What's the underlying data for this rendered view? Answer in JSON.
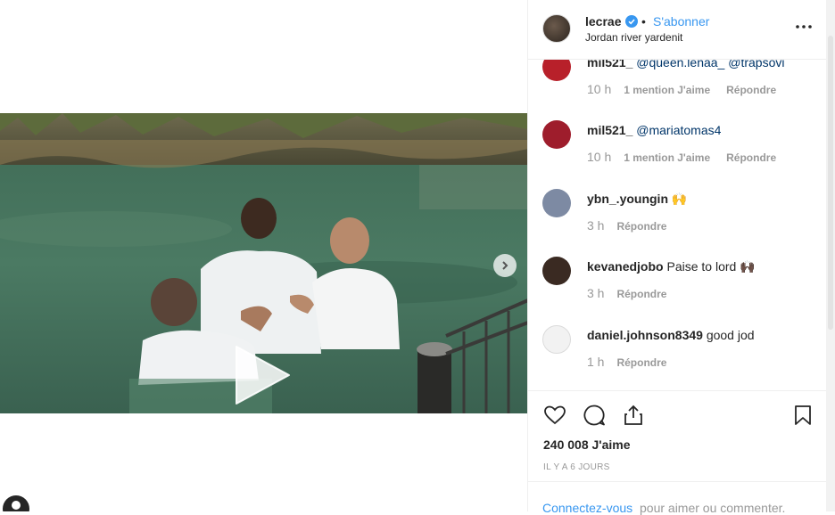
{
  "post": {
    "username": "lecrae",
    "dot": "•",
    "follow_label": "S'abonner",
    "location": "Jordan river yardenit",
    "likes": "240 008 J'aime",
    "timestamp": "IL Y A 6 JOURS"
  },
  "comments": [
    {
      "username": "mil521_",
      "text": "",
      "mentions": "@queen.lenaa_ @trapsovi",
      "time": "10 h",
      "likes": "1 mention J'aime",
      "reply": "Répondre",
      "avatar_color": "#b8202a"
    },
    {
      "username": "mil521_",
      "text": "",
      "mentions": "@mariatomas4",
      "time": "10 h",
      "likes": "1 mention J'aime",
      "reply": "Répondre",
      "avatar_color": "#9e1d2c"
    },
    {
      "username": "ybn_.youngin",
      "text": "🙌",
      "mentions": "",
      "time": "3 h",
      "likes": "",
      "reply": "Répondre",
      "avatar_color": "#7d8aa3"
    },
    {
      "username": "kevanedjobo",
      "text": "Paise to lord 🙌🏿",
      "mentions": "",
      "time": "3 h",
      "likes": "",
      "reply": "Répondre",
      "avatar_color": "#3a2a22"
    },
    {
      "username": "daniel.johnson8349",
      "text": "good jod",
      "mentions": "",
      "time": "1 h",
      "likes": "",
      "reply": "Répondre",
      "avatar_color": "#dbdbdb"
    }
  ],
  "login": {
    "link": "Connectez-vous",
    "rest": "pour aimer ou commenter."
  },
  "icons": [
    "play-icon",
    "chevron-right-icon",
    "verified-badge-icon",
    "more-options-icon",
    "heart-icon",
    "comment-icon",
    "share-icon",
    "bookmark-icon"
  ],
  "colors": {
    "accent": "#3897f0",
    "mention": "#003569",
    "muted": "#999999"
  }
}
